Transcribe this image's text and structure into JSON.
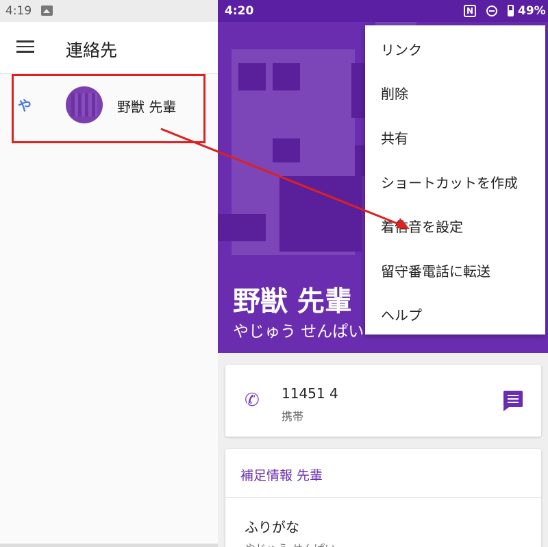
{
  "left": {
    "status_time": "4:19",
    "status_icon": "image-icon",
    "title": "連絡先",
    "index_letter": "や",
    "contact_name": "野獣 先輩"
  },
  "right": {
    "status_time": "4:20",
    "status_icons": [
      "nfc-icon",
      "do-not-disturb-icon",
      "battery-icon"
    ],
    "battery": "49%",
    "contact_name": "野獣 先輩",
    "contact_kana": "やじゅう せんぱい",
    "phone": {
      "number": "11451 4",
      "type": "携帯"
    },
    "info": {
      "title": "補足情報 先輩",
      "furigana_label": "ふりがな",
      "furigana_value": "やじゅう せんぱい"
    },
    "menu_items": [
      "リンク",
      "削除",
      "共有",
      "ショートカットを作成",
      "着信音を設定",
      "留守番電話に転送",
      "ヘルプ"
    ]
  },
  "colors": {
    "accent": "#6a2db0",
    "status_bar": "#5b1fa3",
    "annotation": "#dd2020",
    "index_letter": "#4d79e6"
  }
}
